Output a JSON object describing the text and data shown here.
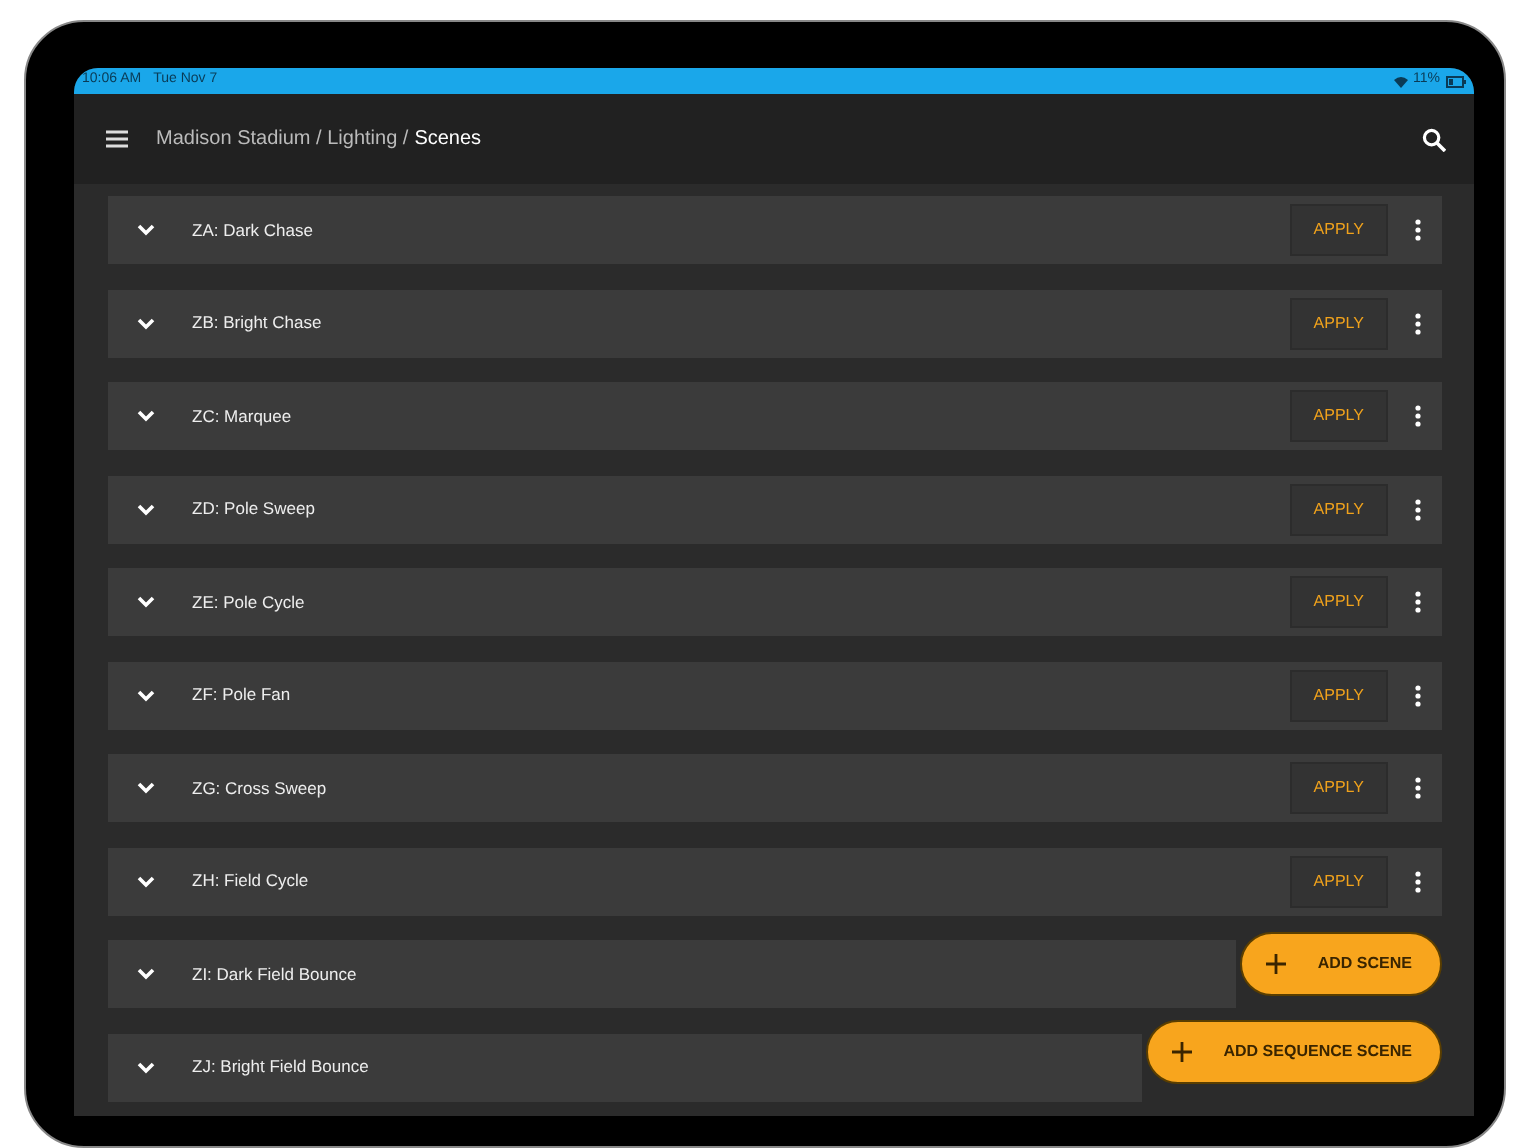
{
  "status_bar": {
    "time": "10:06 AM",
    "date": "Tue Nov 7",
    "battery": "11%"
  },
  "app_bar": {
    "breadcrumb_path": "Madison Stadium / Lighting /",
    "current": "Scenes"
  },
  "scenes": [
    {
      "name": "ZA: Dark Chase",
      "expanded": false,
      "action": "APPLY"
    },
    {
      "name": "ZB: Bright Chase",
      "expanded": false,
      "action": "APPLY"
    },
    {
      "name": "ZC: Marquee",
      "expanded": false,
      "action": "APPLY"
    },
    {
      "name": "ZD: Pole Sweep",
      "expanded": false,
      "action": "APPLY"
    },
    {
      "name": "ZE: Pole Cycle",
      "expanded": false,
      "action": "APPLY"
    },
    {
      "name": "ZF: Pole Fan",
      "expanded": false,
      "action": "APPLY"
    },
    {
      "name": "ZG: Cross Sweep",
      "expanded": false,
      "action": "APPLY"
    },
    {
      "name": "ZH: Field Cycle",
      "expanded": false,
      "action": "APPLY"
    },
    {
      "name": "ZI: Dark Field Bounce",
      "expanded": false
    },
    {
      "name": "ZJ: Bright Field Bounce",
      "expanded": false
    }
  ],
  "fabs": [
    "ADD SCENE",
    "ADD SEQUENCE SCENE"
  ]
}
